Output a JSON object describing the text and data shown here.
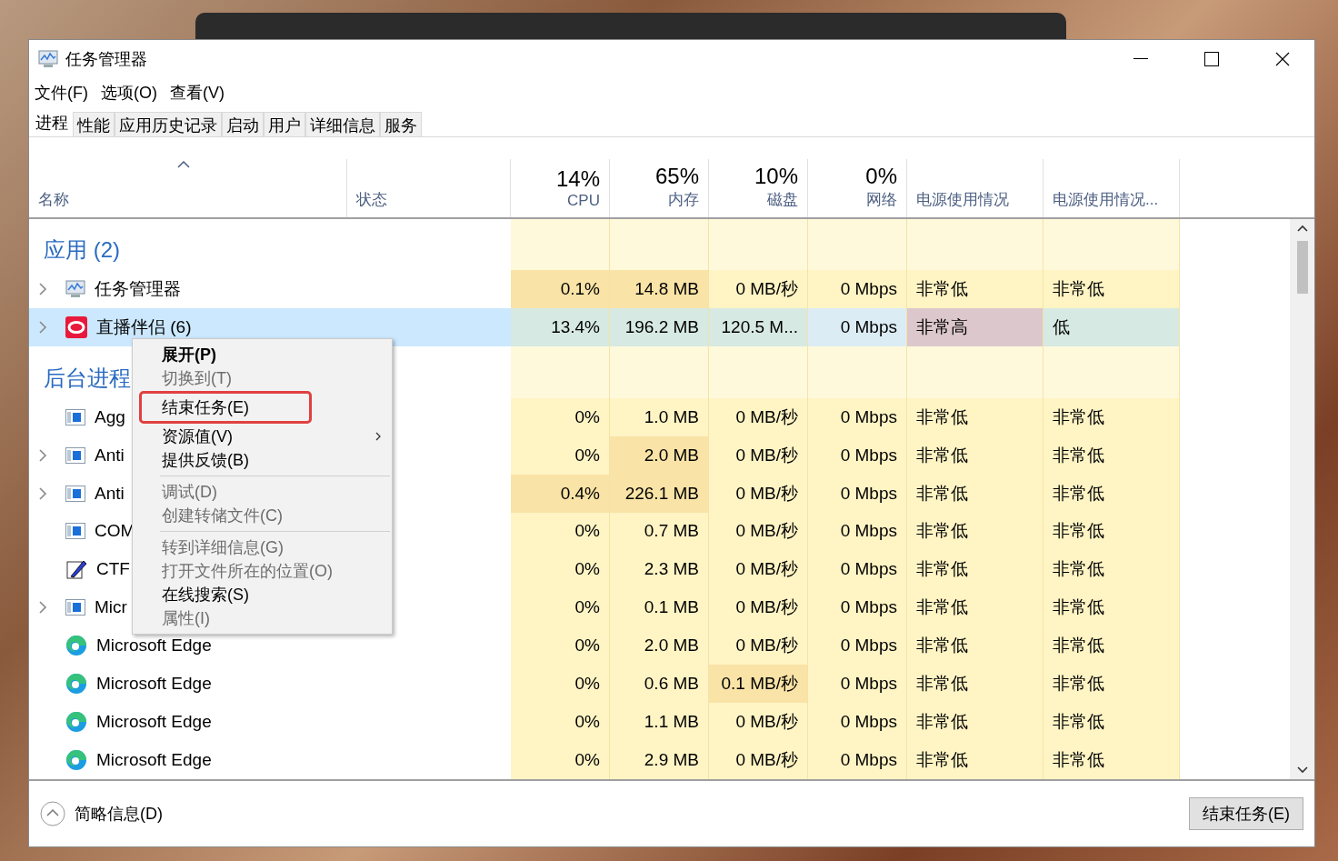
{
  "window": {
    "title": "任务管理器"
  },
  "menu": [
    "文件(F)",
    "选项(O)",
    "查看(V)"
  ],
  "tabs": [
    {
      "label": "进程",
      "selected": true
    },
    {
      "label": "性能",
      "selected": false
    },
    {
      "label": "应用历史记录",
      "selected": false
    },
    {
      "label": "启动",
      "selected": false
    },
    {
      "label": "用户",
      "selected": false
    },
    {
      "label": "详细信息",
      "selected": false
    },
    {
      "label": "服务",
      "selected": false
    }
  ],
  "columns": [
    {
      "label": "名称",
      "sorted": true
    },
    {
      "label": "状态",
      "sorted": false
    },
    {
      "percent": "14%",
      "label": "CPU",
      "sorted": false
    },
    {
      "percent": "65%",
      "label": "内存",
      "sorted": false
    },
    {
      "percent": "10%",
      "label": "磁盘",
      "sorted": false
    },
    {
      "percent": "0%",
      "label": "网络",
      "sorted": false
    },
    {
      "label": "电源使用情况",
      "sorted": false
    },
    {
      "label": "电源使用情况...",
      "sorted": false
    }
  ],
  "groups": [
    {
      "title": "应用 (2)",
      "rows": [
        {
          "name": "任务管理器",
          "kind": "taskmgr",
          "expanded": false,
          "selected": false,
          "cells": [
            {
              "text": "0.1%",
              "hot": true
            },
            {
              "text": "14.8 MB",
              "hot": true
            },
            {
              "text": "0 MB/秒",
              "hot": false
            },
            {
              "text": "0 Mbps",
              "hot": false
            },
            {
              "text": "非常低",
              "hot": false
            },
            {
              "text": "非常低",
              "hot": false
            }
          ]
        },
        {
          "name": "直播伴侣 (6)",
          "kind": "app",
          "expanded": false,
          "selected": true,
          "cells": [
            {
              "text": "13.4%",
              "hot": false
            },
            {
              "text": "196.2 MB",
              "hot": false
            },
            {
              "text": "120.5 M...",
              "hot": false
            },
            {
              "text": "0 Mbps",
              "hot": false
            },
            {
              "text": "非常高",
              "hot": true
            },
            {
              "text": "低",
              "hot": false
            }
          ]
        }
      ]
    },
    {
      "title": "后台进程",
      "rows": [
        {
          "name": "Agg",
          "kind": "window",
          "selected": false,
          "cells": [
            {
              "text": "0%",
              "hot": false
            },
            {
              "text": "1.0 MB",
              "hot": false
            },
            {
              "text": "0 MB/秒",
              "hot": false
            },
            {
              "text": "0 Mbps",
              "hot": false
            },
            {
              "text": "非常低",
              "hot": false
            },
            {
              "text": "非常低",
              "hot": false
            }
          ]
        },
        {
          "name": "Anti",
          "kind": "window",
          "expanded": false,
          "selected": false,
          "cells": [
            {
              "text": "0%",
              "hot": false
            },
            {
              "text": "2.0 MB",
              "hot": true
            },
            {
              "text": "0 MB/秒",
              "hot": false
            },
            {
              "text": "0 Mbps",
              "hot": false
            },
            {
              "text": "非常低",
              "hot": false
            },
            {
              "text": "非常低",
              "hot": false
            }
          ]
        },
        {
          "name": "Anti",
          "kind": "window",
          "expanded": false,
          "selected": false,
          "cells": [
            {
              "text": "0.4%",
              "hot": true
            },
            {
              "text": "226.1 MB",
              "hot": true
            },
            {
              "text": "0 MB/秒",
              "hot": false
            },
            {
              "text": "0 Mbps",
              "hot": false
            },
            {
              "text": "非常低",
              "hot": false
            },
            {
              "text": "非常低",
              "hot": false
            }
          ]
        },
        {
          "name": "COM",
          "kind": "window",
          "selected": false,
          "cells": [
            {
              "text": "0%",
              "hot": false
            },
            {
              "text": "0.7 MB",
              "hot": false
            },
            {
              "text": "0 MB/秒",
              "hot": false
            },
            {
              "text": "0 Mbps",
              "hot": false
            },
            {
              "text": "非常低",
              "hot": false
            },
            {
              "text": "非常低",
              "hot": false
            }
          ]
        },
        {
          "name": "CTF",
          "kind": "pen",
          "selected": false,
          "cells": [
            {
              "text": "0%",
              "hot": false
            },
            {
              "text": "2.3 MB",
              "hot": false
            },
            {
              "text": "0 MB/秒",
              "hot": false
            },
            {
              "text": "0 Mbps",
              "hot": false
            },
            {
              "text": "非常低",
              "hot": false
            },
            {
              "text": "非常低",
              "hot": false
            }
          ]
        },
        {
          "name": "Micr",
          "kind": "window",
          "expanded": false,
          "selected": false,
          "cells": [
            {
              "text": "0%",
              "hot": false
            },
            {
              "text": "0.1 MB",
              "hot": false
            },
            {
              "text": "0 MB/秒",
              "hot": false
            },
            {
              "text": "0 Mbps",
              "hot": false
            },
            {
              "text": "非常低",
              "hot": false
            },
            {
              "text": "非常低",
              "hot": false
            }
          ]
        },
        {
          "name": "Microsoft Edge",
          "kind": "edge",
          "selected": false,
          "cells": [
            {
              "text": "0%",
              "hot": false
            },
            {
              "text": "2.0 MB",
              "hot": false
            },
            {
              "text": "0 MB/秒",
              "hot": false
            },
            {
              "text": "0 Mbps",
              "hot": false
            },
            {
              "text": "非常低",
              "hot": false
            },
            {
              "text": "非常低",
              "hot": false
            }
          ]
        },
        {
          "name": "Microsoft Edge",
          "kind": "edge",
          "selected": false,
          "cells": [
            {
              "text": "0%",
              "hot": false
            },
            {
              "text": "0.6 MB",
              "hot": false
            },
            {
              "text": "0.1 MB/秒",
              "hot": true
            },
            {
              "text": "0 Mbps",
              "hot": false
            },
            {
              "text": "非常低",
              "hot": false
            },
            {
              "text": "非常低",
              "hot": false
            }
          ]
        },
        {
          "name": "Microsoft Edge",
          "kind": "edge",
          "selected": false,
          "cells": [
            {
              "text": "0%",
              "hot": false
            },
            {
              "text": "1.1 MB",
              "hot": false
            },
            {
              "text": "0 MB/秒",
              "hot": false
            },
            {
              "text": "0 Mbps",
              "hot": false
            },
            {
              "text": "非常低",
              "hot": false
            },
            {
              "text": "非常低",
              "hot": false
            }
          ]
        },
        {
          "name": "Microsoft Edge",
          "kind": "edge",
          "selected": false,
          "cells": [
            {
              "text": "0%",
              "hot": false
            },
            {
              "text": "2.9 MB",
              "hot": false
            },
            {
              "text": "0 MB/秒",
              "hot": false
            },
            {
              "text": "0 Mbps",
              "hot": false
            },
            {
              "text": "非常低",
              "hot": false
            },
            {
              "text": "非常低",
              "hot": false
            }
          ]
        }
      ]
    }
  ],
  "context_menu": [
    {
      "kind": "default",
      "label": "展开(P)",
      "disabled": false,
      "highlighted": false
    },
    {
      "kind": "item",
      "label": "切换到(T)",
      "disabled": true,
      "highlighted": false
    },
    {
      "kind": "item",
      "label": "结束任务(E)",
      "disabled": false,
      "highlighted": true
    },
    {
      "kind": "submenu",
      "label": "资源值(V)",
      "disabled": false,
      "highlighted": false
    },
    {
      "kind": "item",
      "label": "提供反馈(B)",
      "disabled": false,
      "highlighted": false
    },
    {
      "kind": "separator"
    },
    {
      "kind": "item",
      "label": "调试(D)",
      "disabled": true,
      "highlighted": false
    },
    {
      "kind": "item",
      "label": "创建转储文件(C)",
      "disabled": true,
      "highlighted": false
    },
    {
      "kind": "separator"
    },
    {
      "kind": "item",
      "label": "转到详细信息(G)",
      "disabled": true,
      "highlighted": false
    },
    {
      "kind": "item",
      "label": "打开文件所在的位置(O)",
      "disabled": true,
      "highlighted": false
    },
    {
      "kind": "item",
      "label": "在线搜索(S)",
      "disabled": false,
      "highlighted": false
    },
    {
      "kind": "item",
      "label": "属性(I)",
      "disabled": true,
      "highlighted": false
    }
  ],
  "footer": {
    "details": "简略信息(D)",
    "button": "结束任务(E)"
  }
}
